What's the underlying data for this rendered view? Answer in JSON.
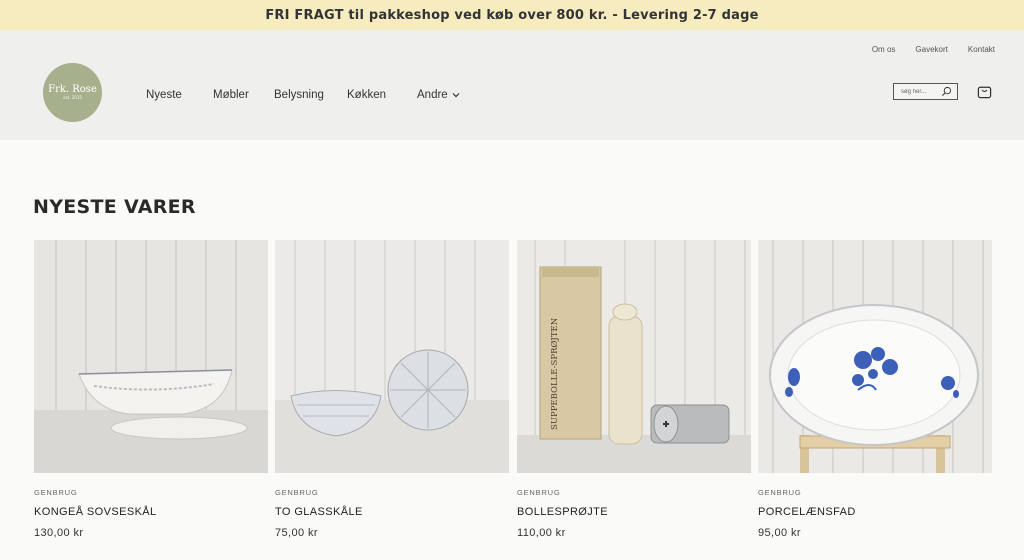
{
  "announcement": "FRI FRAGT til pakkeshop ved køb over 800 kr. - Levering 2-7 dage",
  "logo": {
    "name": "Frk. Rose",
    "sub": "est. 2015"
  },
  "nav": [
    "Nyeste",
    "Møbler",
    "Belysning",
    "Køkken",
    "Andre"
  ],
  "top_links": [
    "Om os",
    "Gavekort",
    "Kontakt"
  ],
  "search": {
    "placeholder": "søg her..."
  },
  "icons": {
    "search": "search-icon",
    "cart": "shopping-bag-icon",
    "dropdown": "chevron-down-icon"
  },
  "section_title": "NYESTE VARER",
  "products": [
    {
      "category": "GENBRUG",
      "name": "KONGEÅ SOVSESKÅL",
      "price": "130,00 kr"
    },
    {
      "category": "GENBRUG",
      "name": "TO GLASSKÅLE",
      "price": "75,00 kr"
    },
    {
      "category": "GENBRUG",
      "name": "BOLLESPRØJTE",
      "price": "110,00 kr"
    },
    {
      "category": "GENBRUG",
      "name": "PORCELÆNSFAD",
      "price": "95,00 kr"
    }
  ],
  "product_image_text": "SUPPEBOLLE-SPRØJTEN",
  "colors": {
    "announcement_bg": "#f6ecc0",
    "header_bg": "#efefee",
    "logo_bg": "#a7b08c",
    "accent_blue": "#3c5fb8"
  }
}
